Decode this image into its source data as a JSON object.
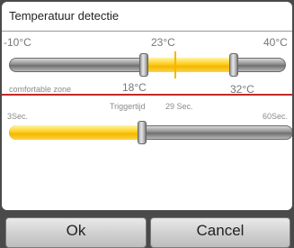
{
  "dialog": {
    "title": "Temperatuur detectie"
  },
  "temperature": {
    "min_label": "-10°C",
    "max_label": "40°C",
    "current_label": "23°C",
    "current_value": 23,
    "range_min": -10,
    "range_max": 40
  },
  "comfort_zone": {
    "label": "comfortable zone",
    "low_label": "18°C",
    "high_label": "32°C",
    "low_value": 18,
    "high_value": 32
  },
  "trigger": {
    "title": "Triggertijd",
    "value_label": "29 Sec.",
    "min_label": "3Sec.",
    "max_label": "60Sec.",
    "value": 29,
    "min": 3,
    "max": 60
  },
  "buttons": {
    "ok": "Ok",
    "cancel": "Cancel"
  },
  "colors": {
    "accent": "#ffd22a",
    "divider": "#c62828"
  }
}
